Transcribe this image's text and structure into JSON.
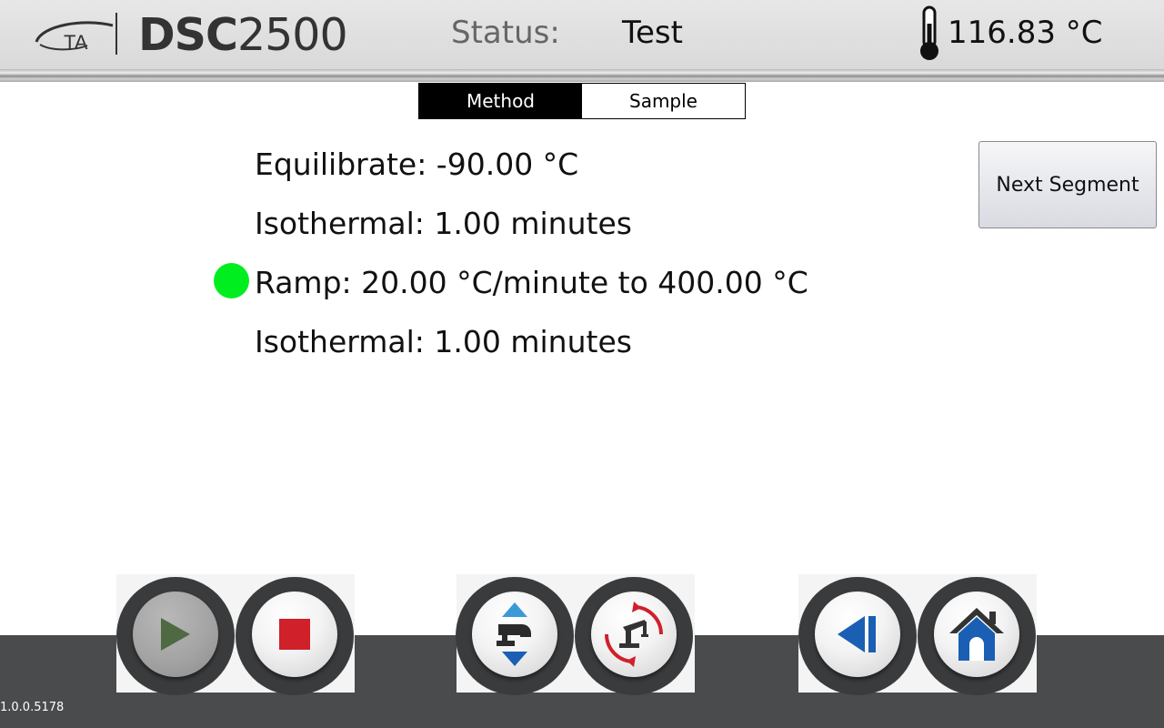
{
  "header": {
    "brand_lettering": "TA",
    "product_bold": "DSC",
    "product_rest": "2500",
    "status_label": "Status:",
    "status_value": "Test",
    "temperature": "116.83 °C"
  },
  "tabs": [
    {
      "label": "Method",
      "active": true
    },
    {
      "label": "Sample",
      "active": false
    }
  ],
  "segments": [
    {
      "text": "Equilibrate: -90.00 °C",
      "active": false
    },
    {
      "text": "Isothermal: 1.00 minutes",
      "active": false
    },
    {
      "text": "Ramp: 20.00 °C/minute to 400.00 °C",
      "active": true
    },
    {
      "text": "Isothermal: 1.00 minutes",
      "active": false
    }
  ],
  "next_segment_label": "Next Segment",
  "footer": {
    "version": "1.0.0.5178",
    "buttons": [
      {
        "icon": "play-icon",
        "enabled": false
      },
      {
        "icon": "stop-icon",
        "enabled": true
      },
      {
        "icon": "lid-open-close-icon",
        "enabled": true
      },
      {
        "icon": "autosampler-icon",
        "enabled": true
      },
      {
        "icon": "back-icon",
        "enabled": true
      },
      {
        "icon": "home-icon",
        "enabled": true
      }
    ]
  },
  "colors": {
    "active_indicator": "#00ee1f",
    "stop": "#d0202a",
    "play_disabled": "#4f6a43",
    "nav_blue": "#1a5fb4",
    "footer_bg": "#4a4b4d"
  }
}
